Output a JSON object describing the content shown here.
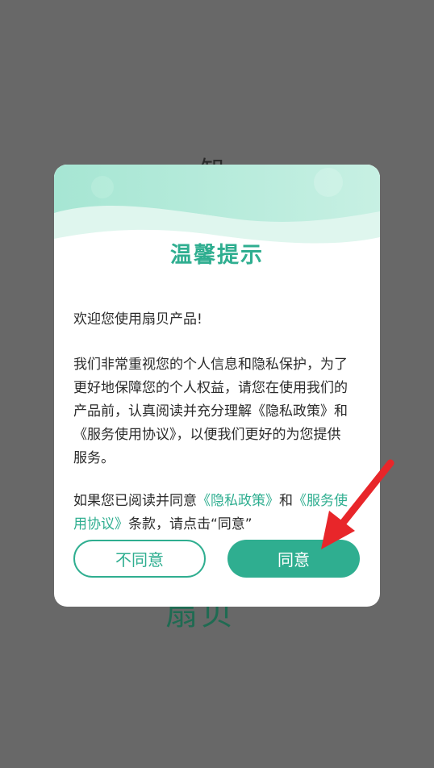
{
  "background": {
    "top_text": "知",
    "bottom_text": "扇贝"
  },
  "dialog": {
    "title": "温馨提示",
    "welcome": "欢迎您使用扇贝产品!",
    "paragraph": "我们非常重视您的个人信息和隐私保护，为了更好地保障您的个人权益，请您在使用我们的产品前，认真阅读并充分理解《隐私政策》和《服务使用协议》，以便我们更好的为您提供服务。",
    "consent": {
      "prefix": "如果您已阅读并同意",
      "privacy_link": "《隐私政策》",
      "middle": "和",
      "terms_link": "《服务使用协议》",
      "suffix": "条款，请点击“同意”"
    },
    "disagree_label": "不同意",
    "agree_label": "同意"
  },
  "colors": {
    "accent": "#2fae90",
    "overlay": "#686868",
    "annotation_arrow": "#e8262a"
  }
}
